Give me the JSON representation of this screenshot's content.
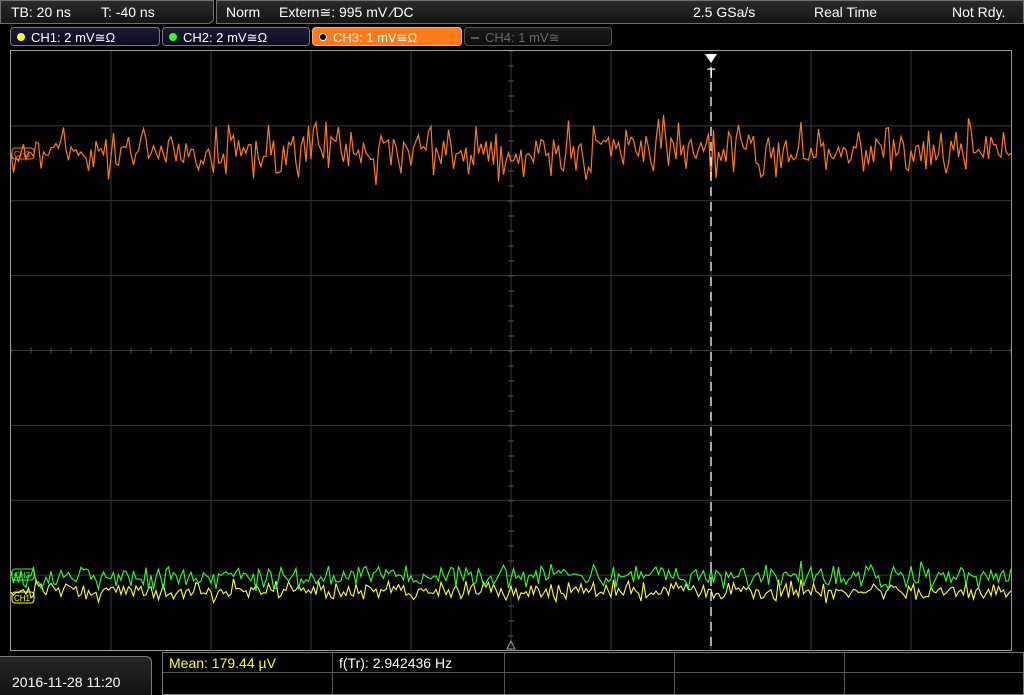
{
  "status_bar": {
    "timebase": "TB: 20 ns",
    "trigger_time": "T: -40 ns",
    "mode": "Norm",
    "trigger_source": "Extern≅: 995 mV ⁄DC",
    "sample_rate": "2.5 GSa/s",
    "acquisition": "Real Time",
    "state": "Not Rdy."
  },
  "channels": [
    {
      "label": "CH1: 2 mV≅Ω",
      "color": "#ffff33",
      "state": "on"
    },
    {
      "label": "CH2: 2 mV≅Ω",
      "color": "#33ff33",
      "state": "on"
    },
    {
      "label": "CH3: 1 mV≅Ω",
      "color": "#ff7a1a",
      "state": "active"
    },
    {
      "label": "CH4: 1 mV≅",
      "color": "#5a5a5a",
      "state": "off"
    }
  ],
  "markers": {
    "trigger_label": "T",
    "ch3_ref": "CH3",
    "ch2_ref": "CH2",
    "ch1_ref": "CH1"
  },
  "bottom": {
    "datetime": "2016-11-28 11:20",
    "mean": "Mean: 179.44 µV",
    "frequency": "f(Tr): 2.942436 Hz"
  },
  "colors": {
    "ch1": "#ffff33",
    "ch2": "#33ff33",
    "ch3": "#ff7a1a",
    "grid": "#3a3a3a",
    "frame": "#9a9a9a",
    "trigger_line": "#ffffff"
  }
}
